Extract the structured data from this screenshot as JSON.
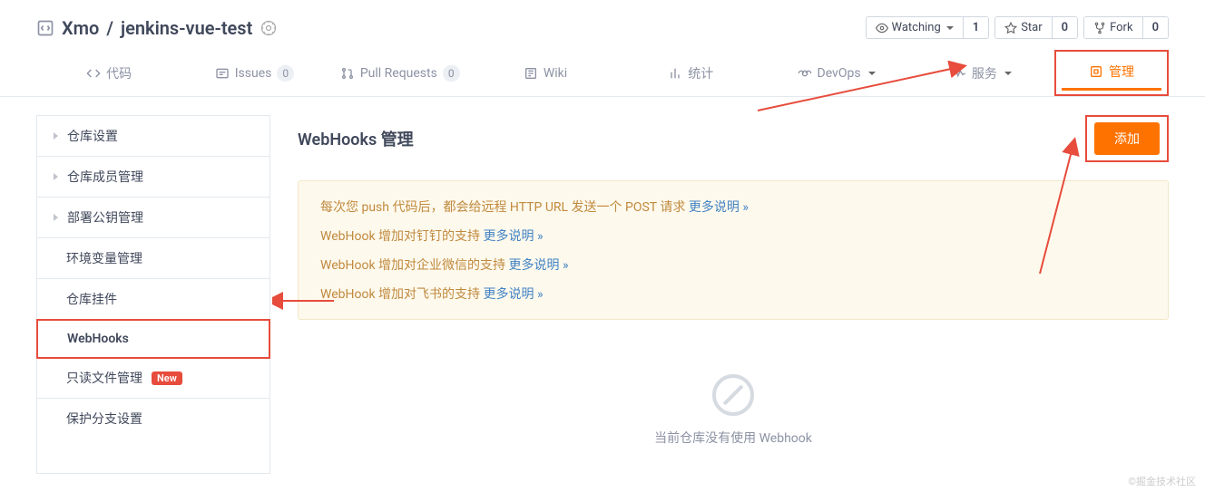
{
  "header": {
    "owner": "Xmo",
    "sep": " / ",
    "repo": "jenkins-vue-test"
  },
  "actions": {
    "watch": {
      "label": "Watching",
      "count": "1"
    },
    "star": {
      "label": "Star",
      "count": "0"
    },
    "fork": {
      "label": "Fork",
      "count": "0"
    }
  },
  "tabs": {
    "code": "代码",
    "issues": "Issues",
    "issues_count": "0",
    "pr": "Pull Requests",
    "pr_count": "0",
    "wiki": "Wiki",
    "stats": "统计",
    "devops": "DevOps",
    "services": "服务",
    "manage": "管理"
  },
  "sidebar": {
    "settings": "仓库设置",
    "members": "仓库成员管理",
    "deploy": "部署公钥管理",
    "env": "环境变量管理",
    "plugins": "仓库挂件",
    "webhooks": "WebHooks",
    "readonly": "只读文件管理",
    "readonly_badge": "New",
    "branch": "保护分支设置"
  },
  "main": {
    "title": "WebHooks 管理",
    "add": "添加",
    "info1_text": "每次您 push 代码后，都会给远程 HTTP URL 发送一个 POST 请求 ",
    "info1_link": "更多说明 »",
    "info2_text": "WebHook 增加对钉钉的支持 ",
    "info2_link": "更多说明 »",
    "info3_text": "WebHook 增加对企业微信的支持 ",
    "info3_link": "更多说明 »",
    "info4_text": "WebHook 增加对飞书的支持 ",
    "info4_link": "更多说明 »",
    "empty": "当前仓库没有使用 Webhook"
  },
  "watermark": "©掘金技术社区"
}
